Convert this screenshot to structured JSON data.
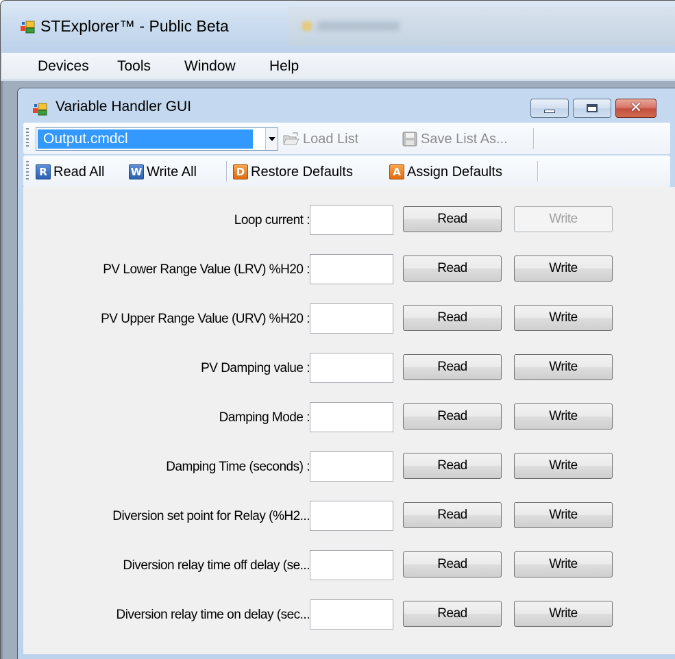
{
  "app": {
    "title": "STExplorer™ - Public Beta"
  },
  "menu": {
    "items": [
      "Devices",
      "Tools",
      "Window",
      "Help"
    ]
  },
  "child_window": {
    "title": "Variable Handler GUI"
  },
  "toolbar1": {
    "combo_value": "Output.cmdcl",
    "load_list_label": "Load List",
    "save_list_label": "Save List As..."
  },
  "toolbar2": {
    "read_all_label": "Read All",
    "write_all_label": "Write All",
    "restore_defaults_label": "Restore Defaults",
    "assign_defaults_label": "Assign Defaults",
    "read_all_icon_letter": "R",
    "write_all_icon_letter": "W",
    "restore_icon_letter": "D",
    "assign_icon_letter": "A"
  },
  "buttons": {
    "read_label": "Read",
    "write_label": "Write"
  },
  "rows": [
    {
      "label": "Loop current :",
      "value": "",
      "write_enabled": false
    },
    {
      "label": "PV Lower Range Value (LRV) %H20 :",
      "value": "",
      "write_enabled": true
    },
    {
      "label": "PV Upper Range Value (URV) %H20 :",
      "value": "",
      "write_enabled": true
    },
    {
      "label": "PV Damping value :",
      "value": "",
      "write_enabled": true
    },
    {
      "label": "Damping Mode :",
      "value": "",
      "write_enabled": true
    },
    {
      "label": "Damping Time (seconds) :",
      "value": "",
      "write_enabled": true
    },
    {
      "label": "Diversion set point for Relay (%H2...",
      "value": "",
      "write_enabled": true
    },
    {
      "label": "Diversion relay time off delay (se...",
      "value": "",
      "write_enabled": true
    },
    {
      "label": "Diversion relay time on delay (sec...",
      "value": "",
      "write_enabled": true
    }
  ],
  "colors": {
    "selection": "#3399ff",
    "icon_blue": "#2b5fb0",
    "icon_orange": "#e06b10",
    "close_red": "#c34f3f"
  }
}
